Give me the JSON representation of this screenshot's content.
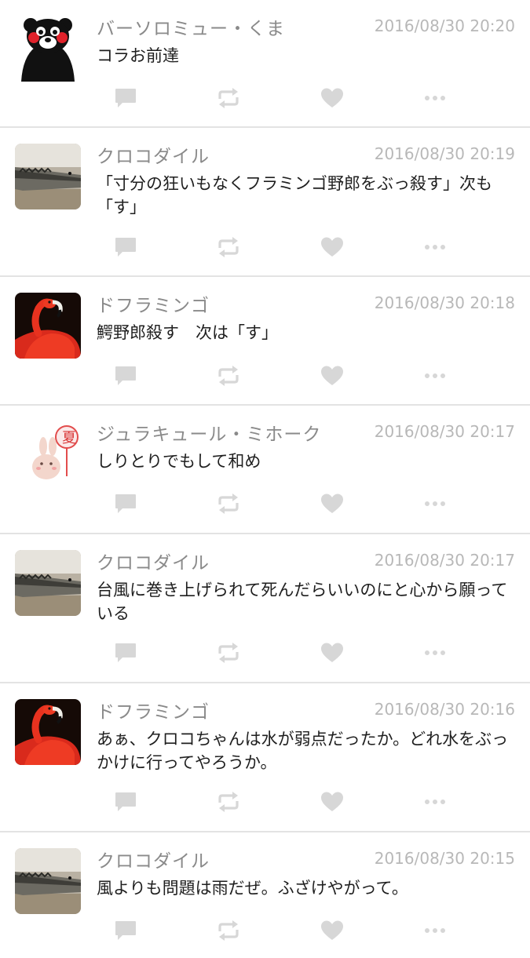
{
  "colors": {
    "name": "#8a8a8a",
    "timestamp": "#b8b8b8",
    "text": "#1f1f1f",
    "icon": "#d7d7d7",
    "divider": "#e3e3e3"
  },
  "posts": [
    {
      "name": "バーソロミュー・くま",
      "timestamp": "2016/08/30 20:20",
      "text": "コラお前達",
      "avatar": "kumamon-bear"
    },
    {
      "name": "クロコダイル",
      "timestamp": "2016/08/30 20:19",
      "text": "「寸分の狂いもなくフラミンゴ野郎をぶっ殺す」次も「す」",
      "avatar": "crocodile"
    },
    {
      "name": "ドフラミンゴ",
      "timestamp": "2016/08/30 20:18",
      "text": "鰐野郎殺す　次は「す」",
      "avatar": "flamingo"
    },
    {
      "name": "ジュラキュール・ミホーク",
      "timestamp": "2016/08/30 20:17",
      "text": "しりとりでもして和め",
      "avatar": "bunny-with-fan"
    },
    {
      "name": "クロコダイル",
      "timestamp": "2016/08/30 20:17",
      "text": "台風に巻き上げられて死んだらいいのにと心から願っている",
      "avatar": "crocodile"
    },
    {
      "name": "ドフラミンゴ",
      "timestamp": "2016/08/30 20:16",
      "text": "あぁ、クロコちゃんは水が弱点だったか。どれ水をぶっかけに行ってやろうか。",
      "avatar": "flamingo"
    },
    {
      "name": "クロコダイル",
      "timestamp": "2016/08/30 20:15",
      "text": "風よりも問題は雨だぜ。ふざけやがって。",
      "avatar": "crocodile"
    }
  ],
  "actions": {
    "reply_icon": "speech-bubble",
    "repost_icon": "repeat-arrows",
    "like_icon": "heart",
    "more_icon": "ellipsis"
  }
}
